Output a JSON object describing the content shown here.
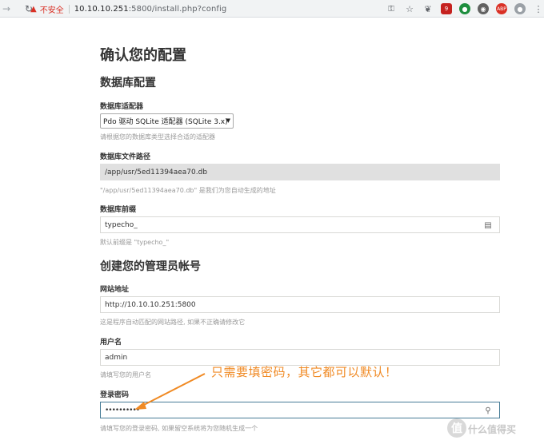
{
  "browser": {
    "insecure_label": "不安全",
    "url_host": "10.10.10.251",
    "url_rest": ":5800/install.php?config",
    "ext_badge": "9",
    "ext_adp": "ABP"
  },
  "page": {
    "title": "确认您的配置",
    "db_section": "数据库配置",
    "db_adapter_label": "数据库适配器",
    "db_adapter_value": "Pdo 驱动 SQLite 适配器 (SQLite 3.x)",
    "db_adapter_hint": "请根据您的数据库类型选择合适的适配器",
    "db_file_label": "数据库文件路径",
    "db_file_value": "/app/usr/5ed11394aea70.db",
    "db_file_hint": "\"/app/usr/5ed11394aea70.db\" 是我们为您自动生成的地址",
    "db_prefix_label": "数据库前缀",
    "db_prefix_value": "typecho_",
    "db_prefix_hint": "默认前缀是 \"typecho_\"",
    "admin_section": "创建您的管理员帐号",
    "site_url_label": "网站地址",
    "site_url_value": "http://10.10.10.251:5800",
    "site_url_hint": "这是程序自动匹配的网站路径, 如果不正确请修改它",
    "username_label": "用户名",
    "username_value": "admin",
    "username_hint": "请填写您的用户名",
    "password_label": "登录密码",
    "password_value": "••••••••••",
    "password_hint": "请填写您的登录密码, 如果留空系统将为您随机生成一个"
  },
  "annotation": {
    "text": "只需要填密码，其它都可以默认！",
    "color": "#f08a24"
  },
  "watermark": {
    "logo": "值",
    "text": "什么值得买"
  }
}
